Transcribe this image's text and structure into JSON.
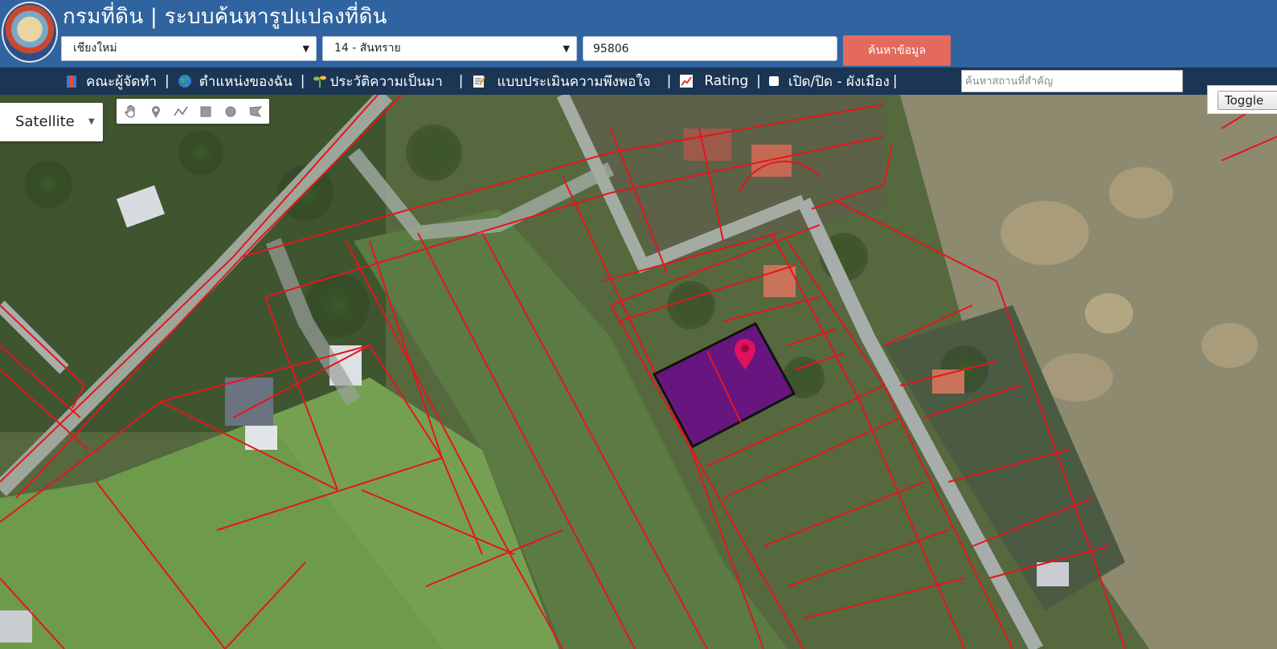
{
  "header": {
    "app_title": "กรมที่ดิน | ระบบค้นหารูปแปลงที่ดิน",
    "province_select": "เชียงใหม่",
    "district_select": "14 - สันทราย",
    "parcel_number": "95806",
    "search_button": "ค้นหาข้อมูล"
  },
  "menu": {
    "items": [
      {
        "label": "คณะผู้จัดทำ",
        "icon": "team-book-icon"
      },
      {
        "label": "ตำแหน่งของฉัน",
        "icon": "globe-icon"
      },
      {
        "label": "ประวัติความเป็นมา",
        "icon": "sprout-icon"
      },
      {
        "label": "แบบประเมินความพึงพอใจ",
        "icon": "memo-icon"
      },
      {
        "label": "Rating",
        "icon": "chart-icon"
      },
      {
        "label": "เปิด/ปิด - ผังเมือง",
        "icon": "checkbox"
      }
    ],
    "separator": "|",
    "place_search_placeholder": "ค้นหาสถานที่สำคัญ"
  },
  "map": {
    "map_type": "Satellite",
    "tools": [
      "hand-icon",
      "marker-icon",
      "polyline-icon",
      "rectangle-icon",
      "circle-icon",
      "polygon-icon"
    ],
    "toggle_label": "Toggle",
    "parcel_color": "#6a0a8a",
    "boundary_color": "#e8141c",
    "marker_color": "#e0115f"
  }
}
